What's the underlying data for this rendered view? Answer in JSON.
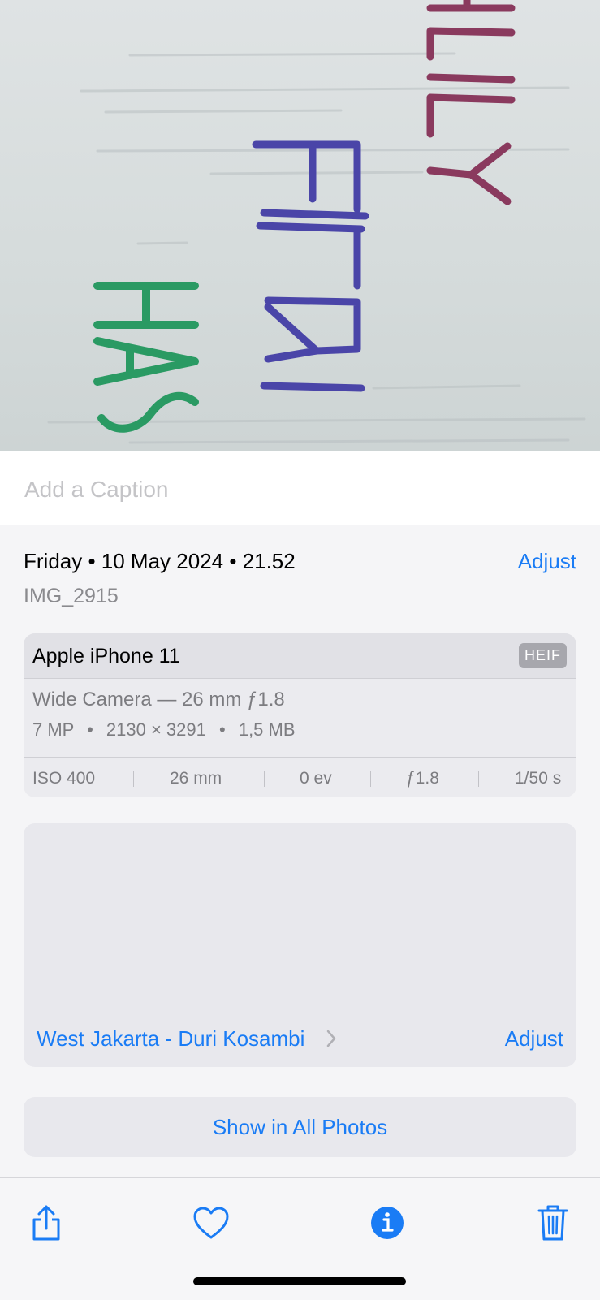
{
  "photo": {
    "handwritten_words": [
      "LILY",
      "FITRI",
      "HAS"
    ],
    "colors": {
      "lily": "#8a3a5e",
      "fitri": "#4a45a8",
      "has": "#2a9a63"
    }
  },
  "caption": {
    "placeholder": "Add a Caption"
  },
  "info": {
    "date": "Friday • 10 May 2024 • 21.52",
    "adjust_label": "Adjust",
    "filename": "IMG_2915"
  },
  "camera": {
    "device": "Apple iPhone 11",
    "format_badge": "HEIF",
    "lens": "Wide Camera — 26 mm ƒ1.8",
    "megapixels": "7 MP",
    "resolution": "2130 × 3291",
    "file_size": "1,5 MB",
    "dot": "•",
    "exif": {
      "iso": "ISO 400",
      "focal": "26 mm",
      "exposure_bias": "0 ev",
      "aperture": "ƒ1.8",
      "shutter": "1/50 s"
    }
  },
  "location": {
    "name": "West Jakarta - Duri Kosambi",
    "adjust_label": "Adjust"
  },
  "show_all_label": "Show in All Photos",
  "toolbar": {
    "icons": [
      "share-icon",
      "heart-icon",
      "info-icon",
      "trash-icon"
    ],
    "accent": "#1a7cf5"
  }
}
